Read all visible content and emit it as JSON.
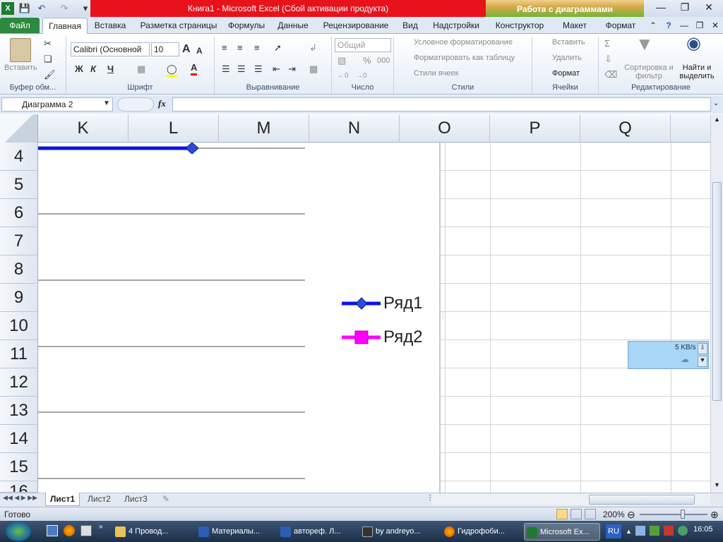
{
  "window": {
    "title": "Книга1  -  Microsoft Excel (Сбой активации продукта)",
    "context_tab_group": "Работа с диаграммами"
  },
  "tabs": [
    "Файл",
    "Главная",
    "Вставка",
    "Разметка страницы",
    "Формулы",
    "Данные",
    "Рецензирование",
    "Вид",
    "Надстройки",
    "Конструктор",
    "Макет",
    "Формат"
  ],
  "ribbon": {
    "clipboard": {
      "paste": "Вставить",
      "label": "Буфер обм..."
    },
    "font": {
      "name": "Calibri (Основной",
      "size": "10",
      "bold": "Ж",
      "italic": "К",
      "underline": "Ч",
      "grow": "A",
      "shrink": "A",
      "font_color_letter": "A",
      "label": "Шрифт"
    },
    "alignment": {
      "label": "Выравнивание"
    },
    "number": {
      "format": "Общий",
      "percent": "%",
      "thousands": "000",
      "label": "Число"
    },
    "styles": {
      "cond": "Условное форматирование",
      "table": "Форматировать как таблицу",
      "cell": "Стили ячеек",
      "label": "Стили"
    },
    "cells": {
      "insert": "Вставить",
      "delete": "Удалить",
      "format": "Формат",
      "label": "Ячейки"
    },
    "editing": {
      "sum": "Σ",
      "sort": "Сортировка и фильтр",
      "find": "Найти и выделить",
      "label": "Редактирование"
    }
  },
  "formula_bar": {
    "name_box": "Диаграмма 2",
    "fx": "fx",
    "value": ""
  },
  "columns": [
    "K",
    "L",
    "M",
    "N",
    "O",
    "P",
    "Q"
  ],
  "rows": [
    "4",
    "5",
    "6",
    "7",
    "8",
    "9",
    "10",
    "11",
    "12",
    "13",
    "14",
    "15",
    "16"
  ],
  "chart_data": {
    "type": "line",
    "series": [
      {
        "name": "Ряд1",
        "color": "#0000ff",
        "marker": "diamond"
      },
      {
        "name": "Ряд2",
        "color": "#ff00ff",
        "marker": "square"
      }
    ],
    "legend_position": "right"
  },
  "network_popup": {
    "speed": "5 KB/s"
  },
  "sheets": [
    "Лист1",
    "Лист2",
    "Лист3"
  ],
  "status": {
    "ready": "Готово",
    "zoom": "200%"
  },
  "taskbar": {
    "items": [
      "4 Провод...",
      "Материалы...",
      "автореф. Л...",
      "by andreyo...",
      "Гидрофоби...",
      "Microsoft Ex..."
    ],
    "lang": "RU",
    "clock": "16:05"
  }
}
